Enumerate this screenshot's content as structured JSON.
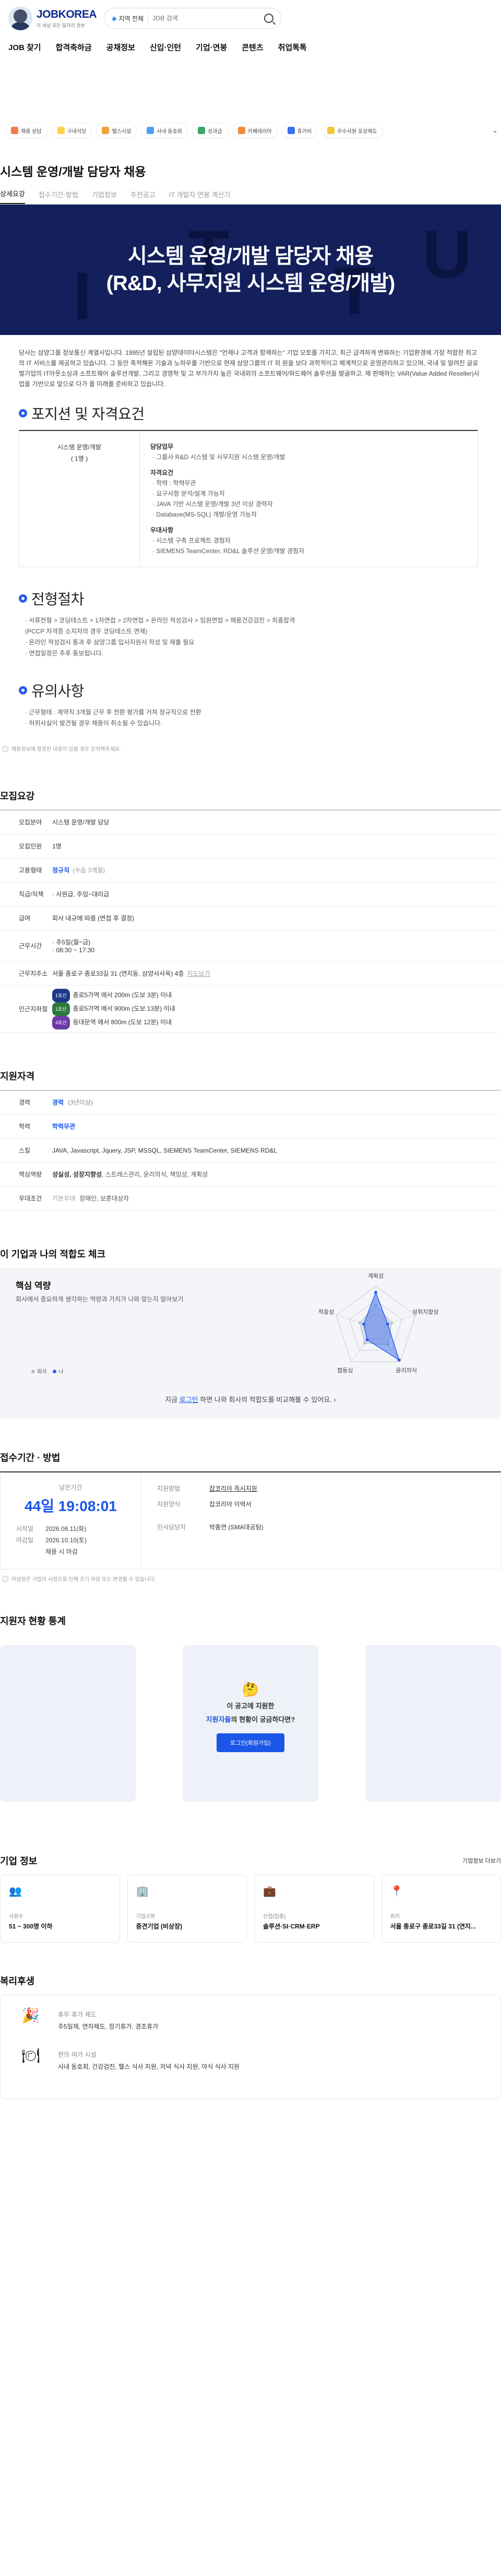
{
  "header": {
    "logo_name": "JOBKOREA",
    "logo_sub": "이 세상 모든 일자리 정보",
    "search_location": "지역 전체",
    "search_placeholder": "JOB 검색"
  },
  "gnb": [
    "JOB 찾기",
    "합격축하금",
    "공채정보",
    "신입·인턴",
    "기업·연봉",
    "콘텐츠",
    "취업톡톡"
  ],
  "banner_chips": [
    {
      "label": "채용 상담",
      "color": "#f07a4a"
    },
    {
      "label": "구내식당",
      "color": "#ffd24a"
    },
    {
      "label": "헬스시설",
      "color": "#f2a33a"
    },
    {
      "label": "사내 동호회",
      "color": "#4aa1f2"
    },
    {
      "label": "성과급",
      "color": "#3aa66b"
    },
    {
      "label": "카페테리아",
      "color": "#f28a3a"
    },
    {
      "label": "휴가비",
      "color": "#3a6ef2"
    },
    {
      "label": "우수사원 포상제도",
      "color": "#f2c73a"
    }
  ],
  "job": {
    "title": "시스템 운영/개발 담당자 채용",
    "tabs": [
      "상세요강",
      "접수기간·방법",
      "기업정보",
      "추천공고",
      "IT 개발자 연봉 계산기"
    ],
    "hero_line1": "시스템 운영/개발 담당자 채용",
    "hero_line2": "(R&D, 사무지원 시스템 운영/개발)",
    "intro": "당사는 삼양그룹 정보통신 계열사입니다. 1995년 설립된 삼양데이타시스템은 \"언제나 고객과 함께하는\" 기업 모토를 가지고, 최근 급격하게 변화하는 기업환경에 가장 적합한 최고의 IT 서비스를 제공하고 있습니다. 그 동안 축적해온 기술과 노하우를 기반으로 현재 삼양그룹의 IT 외 원을 보다 과학적이고 체계적으로 운영관리하고 있으며, 국내 및 알려진 글로벌기업의 IT아웃소싱과 소프트웨어 솔루션개발, 그리고 경영학 및 고 부가가치 높은 국내외의 소프트웨어/하드웨어 솔루션을 발굴하고, 제 판매하는 VAR(Value Added Reseller)사업을 기반으로 앞으로 다가 올 미래를 준비하고 있습니다."
  },
  "position": {
    "heading": "포지션 및 자격요건",
    "role": "시스템 운영/개발",
    "count": "( 1명 )",
    "groups": [
      {
        "title": "담당업무",
        "items": [
          "· 그룹사 R&D 시스템 및 사무지원 시스템 운영/개발"
        ]
      },
      {
        "title": "자격요건",
        "items": [
          "· 학력 : 학력무관",
          "· 요구사항 분석/설계 가능자",
          "· JAVA 기반 시스템 운영/개발 3년 이상 경력자",
          "· Database(MS-SQL) 개발/운영 가능자"
        ]
      },
      {
        "title": "우대사항",
        "items": [
          "· 시스템 구축 프로젝트 경험자",
          "· SIEMENS TeamCenter, RD&L 솔루션 운영/개발 경험자"
        ]
      }
    ]
  },
  "process": {
    "heading": "전형절차",
    "items": [
      "· 서류전형 > 코딩테스트 > 1차면접 > 2차면접 > 온라인 적성검사 > 임원면접 > 채용건강검진 > 최종합격",
      "(PCCP 자격증 소지자의 경우 코딩테스트 면제)",
      "· 온라인 적성검사 통과 후 삼양그룹 입사지원서 작성 및 제출 필요",
      "· 면접일정은 추후 통보됩니다."
    ]
  },
  "notice": {
    "heading": "유의사항",
    "items": [
      "· 근무형태 : 계약직 3개월 근무 후 전환 평가를 거쳐 정규직으로 전환",
      "· 허위사실이 발견될 경우 채용이 취소될 수 있습니다."
    ]
  },
  "report_note": "채용정보에 잘못된 내용이 있을 경우 문의해주세요.",
  "summary": {
    "heading": "모집요강",
    "rows": [
      {
        "k": "모집분야",
        "v": "시스템 운영/개발 담당"
      },
      {
        "k": "모집인원",
        "v": "1명"
      },
      {
        "k": "고용형태",
        "v": "정규직",
        "extra": "(수습 3개월)"
      },
      {
        "k": "직급/직책",
        "v": "· 사원급, 주임~대리급"
      },
      {
        "k": "급여",
        "v": "회사 내규에 따름 (면접 후 결정)"
      },
      {
        "k": "근무시간",
        "v": "· 주5일(월~금)",
        "v2": "· 08:30 ~ 17:30"
      },
      {
        "k": "근무지주소",
        "v": "서울 종로구 종로33길 31 (연지동, 삼양사사옥) 4층",
        "extra": "지도보기"
      },
      {
        "k": "인근지하철",
        "subway": [
          {
            "line": "1호선",
            "tag": "",
            "text": "종로5가역 에서 200m (도보 3분) 이내"
          },
          {
            "line": "1호선",
            "tag": "g",
            "text": "종로5가역 에서 900m (도보 13분) 이내"
          },
          {
            "line": "4호선",
            "tag": "p",
            "text": "동대문역 에서 800m (도보 12분) 이내"
          }
        ]
      }
    ]
  },
  "qualifications": {
    "heading": "지원자격",
    "rows": [
      {
        "k": "경력",
        "v": "경력",
        "extra": "(3년이상)"
      },
      {
        "k": "학력",
        "v": "학력무관"
      },
      {
        "k": "스킬",
        "v": "JAVA, Javascript, Jquery, JSP, MSSQL, SIEMENS TeamCenter, SIEMENS RD&L"
      },
      {
        "k": "핵심역량",
        "v": "성실성, 성장지향성",
        "extra": ", 스트레스관리, 윤리의식, 책임성, 계획성"
      },
      {
        "k": "우대조건",
        "v": "기본우대",
        "extra": "장애인, 보훈대상자"
      }
    ]
  },
  "fit": {
    "heading": "이 기업과 나의 적합도 체크",
    "sub_title": "핵심 역량",
    "desc": "회사에서 중요하게 생각하는 역량과 가치가 나와 맞는지 알아보기",
    "axes": [
      "계획성",
      "성취지향성",
      "윤리의식",
      "협동심",
      "적응성"
    ],
    "legend_company": "회사",
    "legend_me": "나",
    "foot_pre": "지금 ",
    "foot_link": "로그인",
    "foot_post": " 하면 나와 회사의 적합도를 비교해볼 수 있어요.",
    "company_values": [
      0.55,
      0.4,
      0.5,
      0.45,
      0.4
    ],
    "me_values": [
      0.85,
      0.3,
      0.95,
      0.35,
      0.3
    ]
  },
  "apply": {
    "heading": "접수기간 · 방법",
    "remaining_label": "남은기간",
    "countdown": "44일 19:08:01",
    "start_label": "시작일",
    "start": "2026.08.11(화)",
    "end_label": "마감일",
    "end": "2026.10.10(토)",
    "end_note": "채용 시 마감",
    "method_label": "지원방법",
    "method": "잡코리아 즉시지원",
    "form_label": "지원양식",
    "form": "잡코리아 이력서",
    "manager_label": "인사담당자",
    "manager": "박종연 (SMA대공팀)",
    "note": "마감일은 기업의 사정으로 인해 조기 마감 또는 변경될 수 있습니다."
  },
  "stats": {
    "heading": "지원자 현황 통계",
    "msg1": "이 공고에 지원한",
    "msg2a": "지원자들",
    "msg2b": "의 현황이 궁금하다면?",
    "button": "로그인(회원가입)"
  },
  "corp": {
    "heading": "기업 정보",
    "link": "기업정보 더보기",
    "cards": [
      {
        "label": "사원수",
        "value": "51 ~ 300명 이하",
        "icon": "people-icon"
      },
      {
        "label": "기업구분",
        "value": "중견기업 (비상장)",
        "icon": "building-icon"
      },
      {
        "label": "산업(업종)",
        "value": "솔루션·SI·CRM·ERP",
        "icon": "briefcase-icon"
      },
      {
        "label": "위치",
        "value": "서울 종로구 종로33길 31 (연지...",
        "icon": "pin-icon"
      }
    ]
  },
  "welfare": {
    "heading": "복리후생",
    "rows": [
      {
        "k": "휴무·휴가 제도",
        "v": "주5일제, 연차제도, 정기휴가, 경조휴가",
        "icon": "vacation-icon"
      },
      {
        "k": "편의·여가 시설",
        "v": "사내 동호회, 건강검진, 헬스 식사 지원, 저녁 식사 지원, 야식 식사 지원",
        "icon": "meal-icon"
      }
    ]
  }
}
